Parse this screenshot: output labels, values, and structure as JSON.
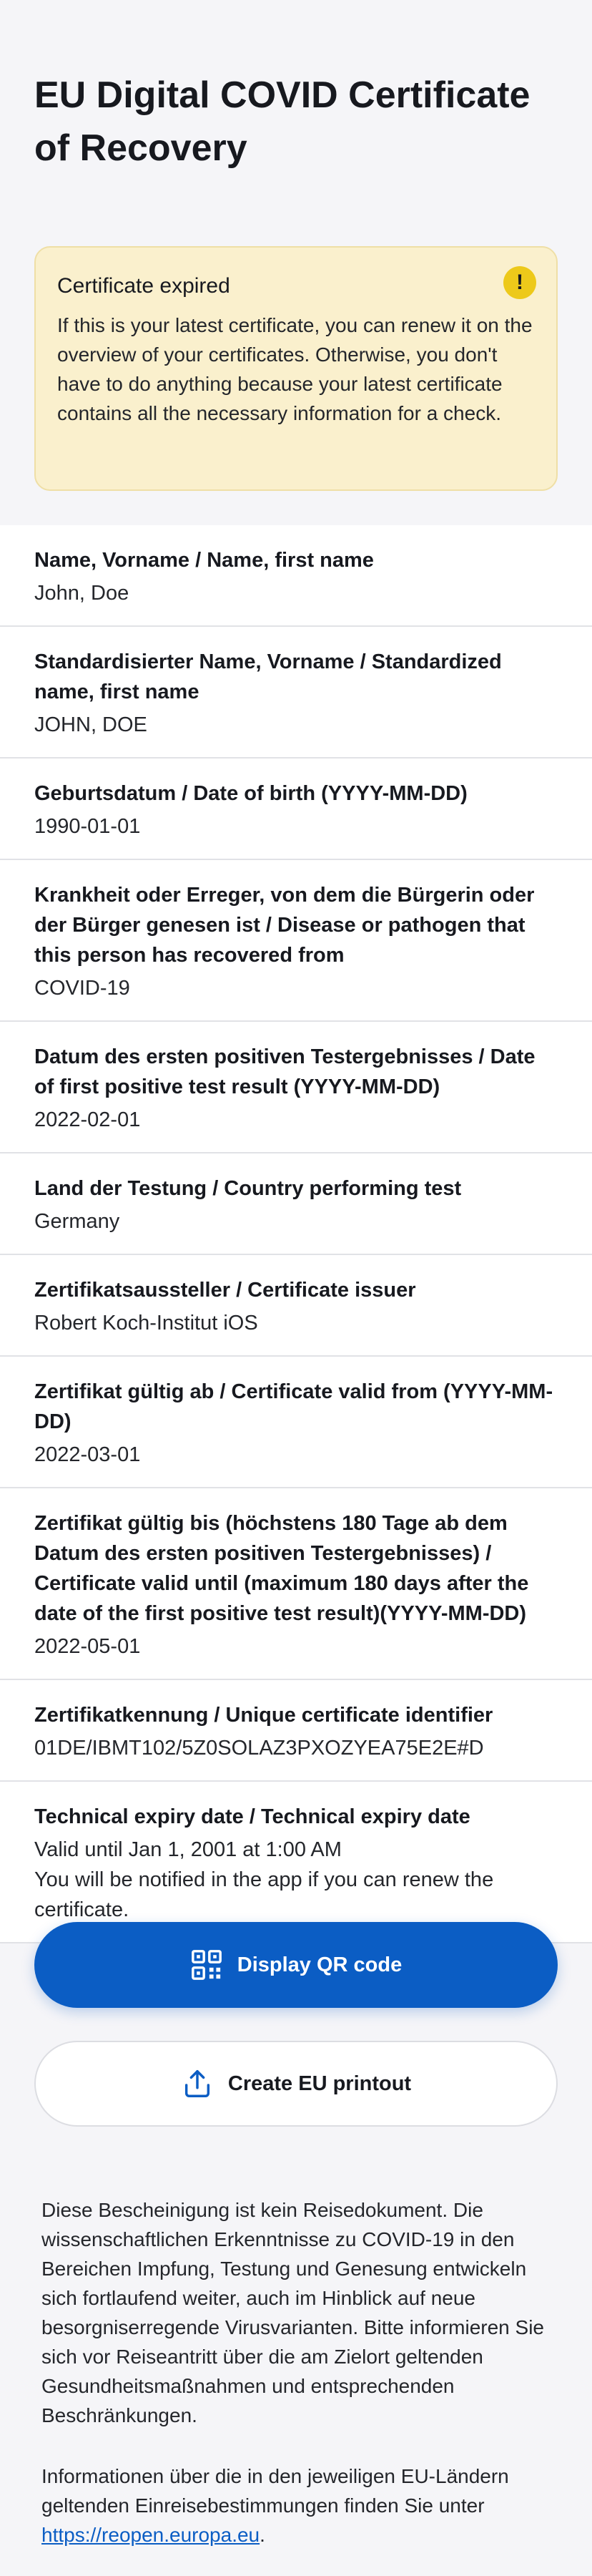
{
  "page": {
    "title": "EU Digital COVID Certificate of Recovery"
  },
  "warning": {
    "title": "Certificate expired",
    "icon": "exclamation-icon",
    "icon_glyph": "!",
    "body": "If this is your latest certificate, you can renew it on the overview of your certificates. Otherwise, you don't have to do anything because your latest certificate contains all the necessary information for a check.",
    "color": "#faf0cd"
  },
  "rows": [
    {
      "label": "Name, Vorname / Name, first name",
      "value": "John, Doe"
    },
    {
      "label": "Standardisierter Name, Vorname / Standardized name, first name",
      "value": "JOHN, DOE"
    },
    {
      "label": "Geburtsdatum / Date of birth (YYYY-MM-DD)",
      "value": "1990-01-01"
    },
    {
      "label": "Krankheit oder Erreger, von dem die Bürgerin oder der Bürger genesen ist / Disease or pathogen that this person has recovered from",
      "value": "COVID-19"
    },
    {
      "label": "Datum des ersten positiven Testergebnisses / Date of first positive test result (YYYY-MM-DD)",
      "value": "2022-02-01"
    },
    {
      "label": "Land der Testung / Country performing test",
      "value": "Germany"
    },
    {
      "label": "Zertifikatsaussteller / Certificate issuer",
      "value": "Robert Koch-Institut iOS"
    },
    {
      "label": "Zertifikat gültig ab / Certificate valid from (YYYY-MM-DD)",
      "value": "2022-03-01"
    },
    {
      "label": "Zertifikat gültig bis (höchstens 180 Tage ab dem Datum des ersten positiven Testergebnisses) / Certificate valid until (maximum 180 days after the date of the first positive test result)(YYYY-MM-DD)",
      "value": "2022-05-01"
    },
    {
      "label": "Zertifikatkennung / Unique certificate identifier",
      "value": "01DE/IBMT102/5Z0SOLAZ3PXOZYEA75E2E#D"
    },
    {
      "label": "Technical expiry date / Technical expiry date",
      "value": "Valid until Jan 1, 2001 at 1:00 AM",
      "note": "You will be notified in the app if you can renew the certificate."
    }
  ],
  "buttons": {
    "qr_label": "Display QR code",
    "qr_icon": "qr-code-icon",
    "print_label": "Create EU printout",
    "print_icon": "share-upload-icon",
    "accent": "#0b5dc4"
  },
  "footer": {
    "paragraph1": "Diese Bescheinigung ist kein Reisedokument. Die wissenschaftlichen Erkenntnisse zu COVID-19 in den Bereichen Impfung, Testung und Genesung entwickeln sich fortlaufend weiter, auch im Hinblick auf neue besorgniserregende Virusvarianten. Bitte informieren Sie sich vor Reiseantritt über die am Zielort geltenden Gesundheitsmaßnahmen und entsprechenden Beschränkungen.",
    "paragraph2_prefix": "Informationen über die in den jeweiligen EU-Ländern geltenden Einreisebestimmungen finden Sie unter ",
    "link": "https://reopen.europa.eu",
    "paragraph2_suffix": "."
  }
}
